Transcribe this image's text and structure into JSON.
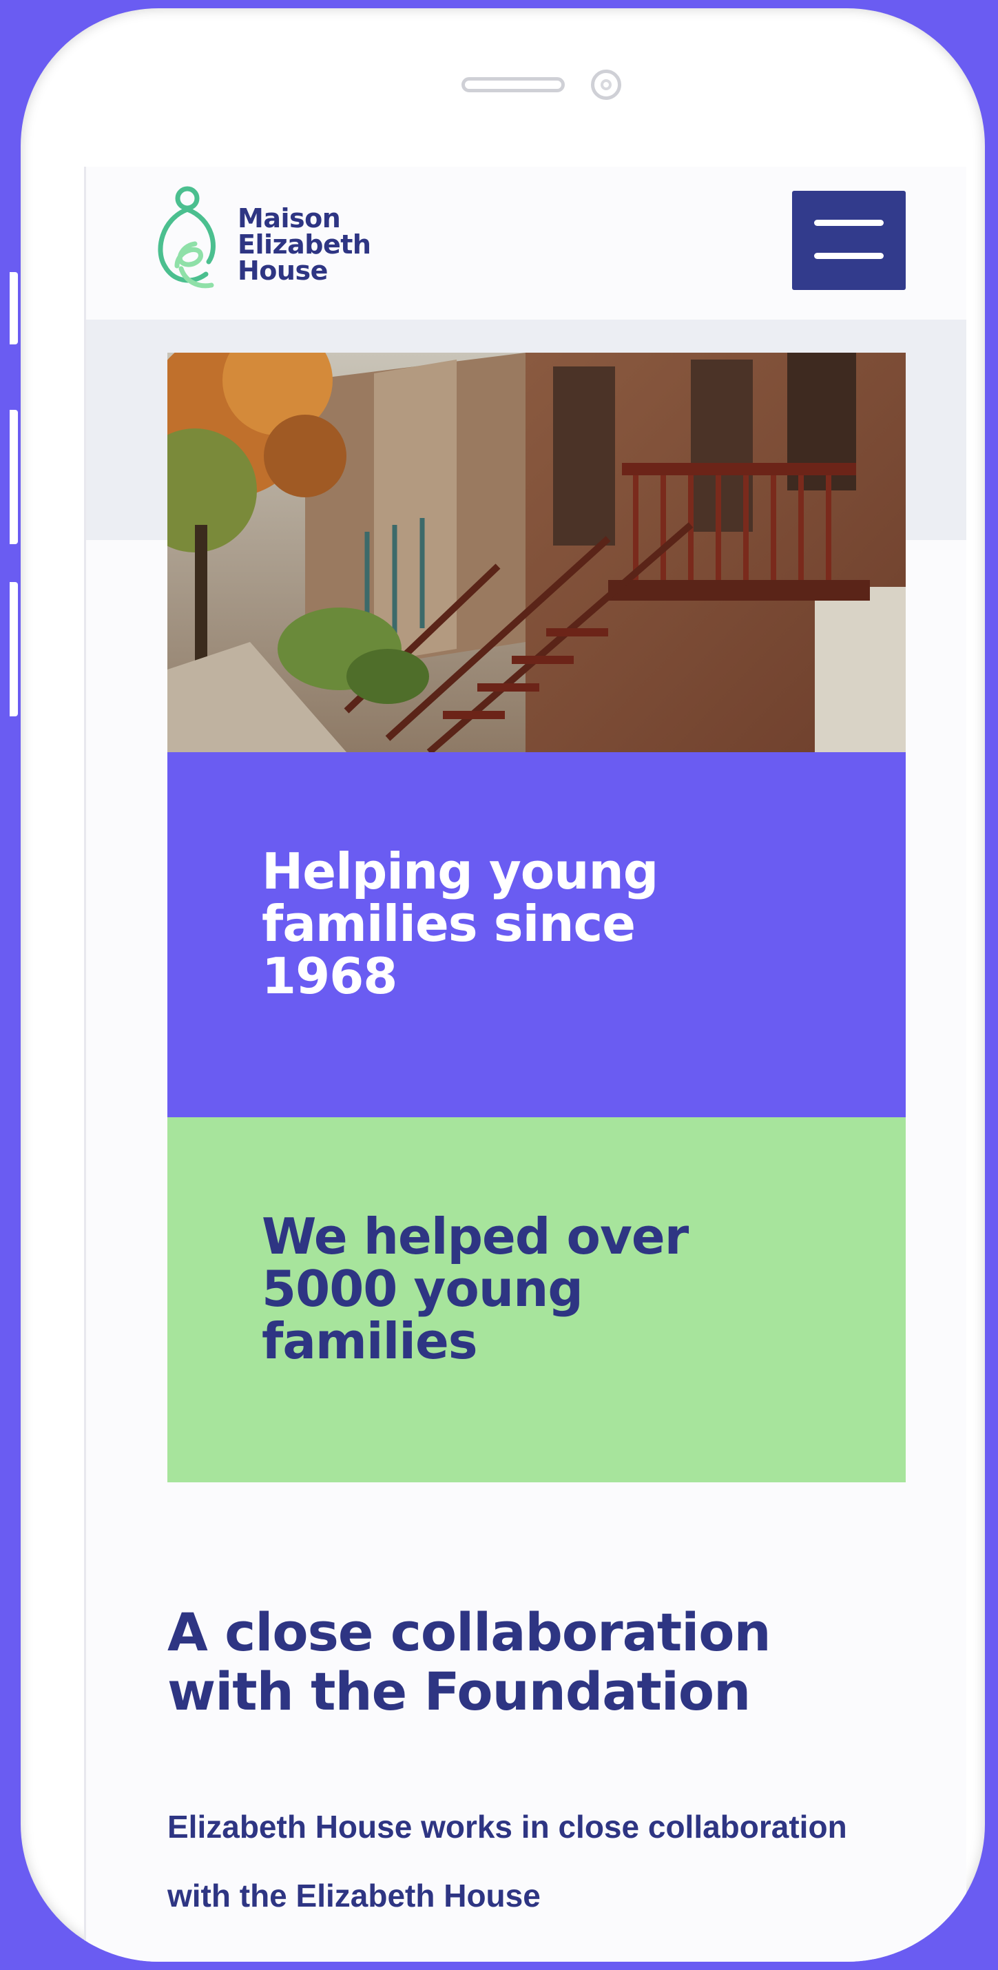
{
  "brand": {
    "line1": "Maison",
    "line2": "Elizabeth",
    "line3": "House",
    "icon": "mother-child-logo-icon",
    "colors": {
      "navy": "#2e3583",
      "green": "#5ec79b",
      "purple": "#6a5cf2",
      "light_green": "#a7e49c"
    }
  },
  "header": {
    "menu_icon": "hamburger-menu-icon"
  },
  "hero": {
    "image": "row-houses-autumn-street-photo"
  },
  "stats": {
    "since": "Helping young families since 1968",
    "helped": "We helped over 5000 young families"
  },
  "section": {
    "title": "A close collaboration with the Foundation",
    "body": "Elizabeth House works in close collaboration with the Elizabeth House"
  }
}
